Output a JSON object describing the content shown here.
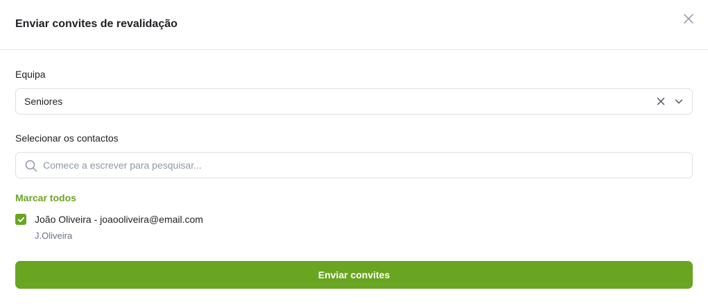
{
  "dialog": {
    "title": "Enviar convites de revalidação"
  },
  "team": {
    "label": "Equipa",
    "selected": "Seniores"
  },
  "contacts": {
    "label": "Selecionar os contactos",
    "search_placeholder": "Comece a escrever para pesquisar...",
    "mark_all_label": "Marcar todos",
    "items": [
      {
        "name": "João Oliveira - joaooliveira@email.com",
        "username": "J.Oliveira",
        "checked": true
      }
    ]
  },
  "actions": {
    "submit_label": "Enviar convites"
  },
  "colors": {
    "accent": "#6aa521",
    "border": "#dcdfe4",
    "placeholder": "#8f98a8"
  },
  "icons": {
    "close": "close-icon",
    "clear": "clear-selection-icon",
    "chevron": "chevron-down-icon",
    "search": "search-icon",
    "check": "checkmark-icon"
  }
}
